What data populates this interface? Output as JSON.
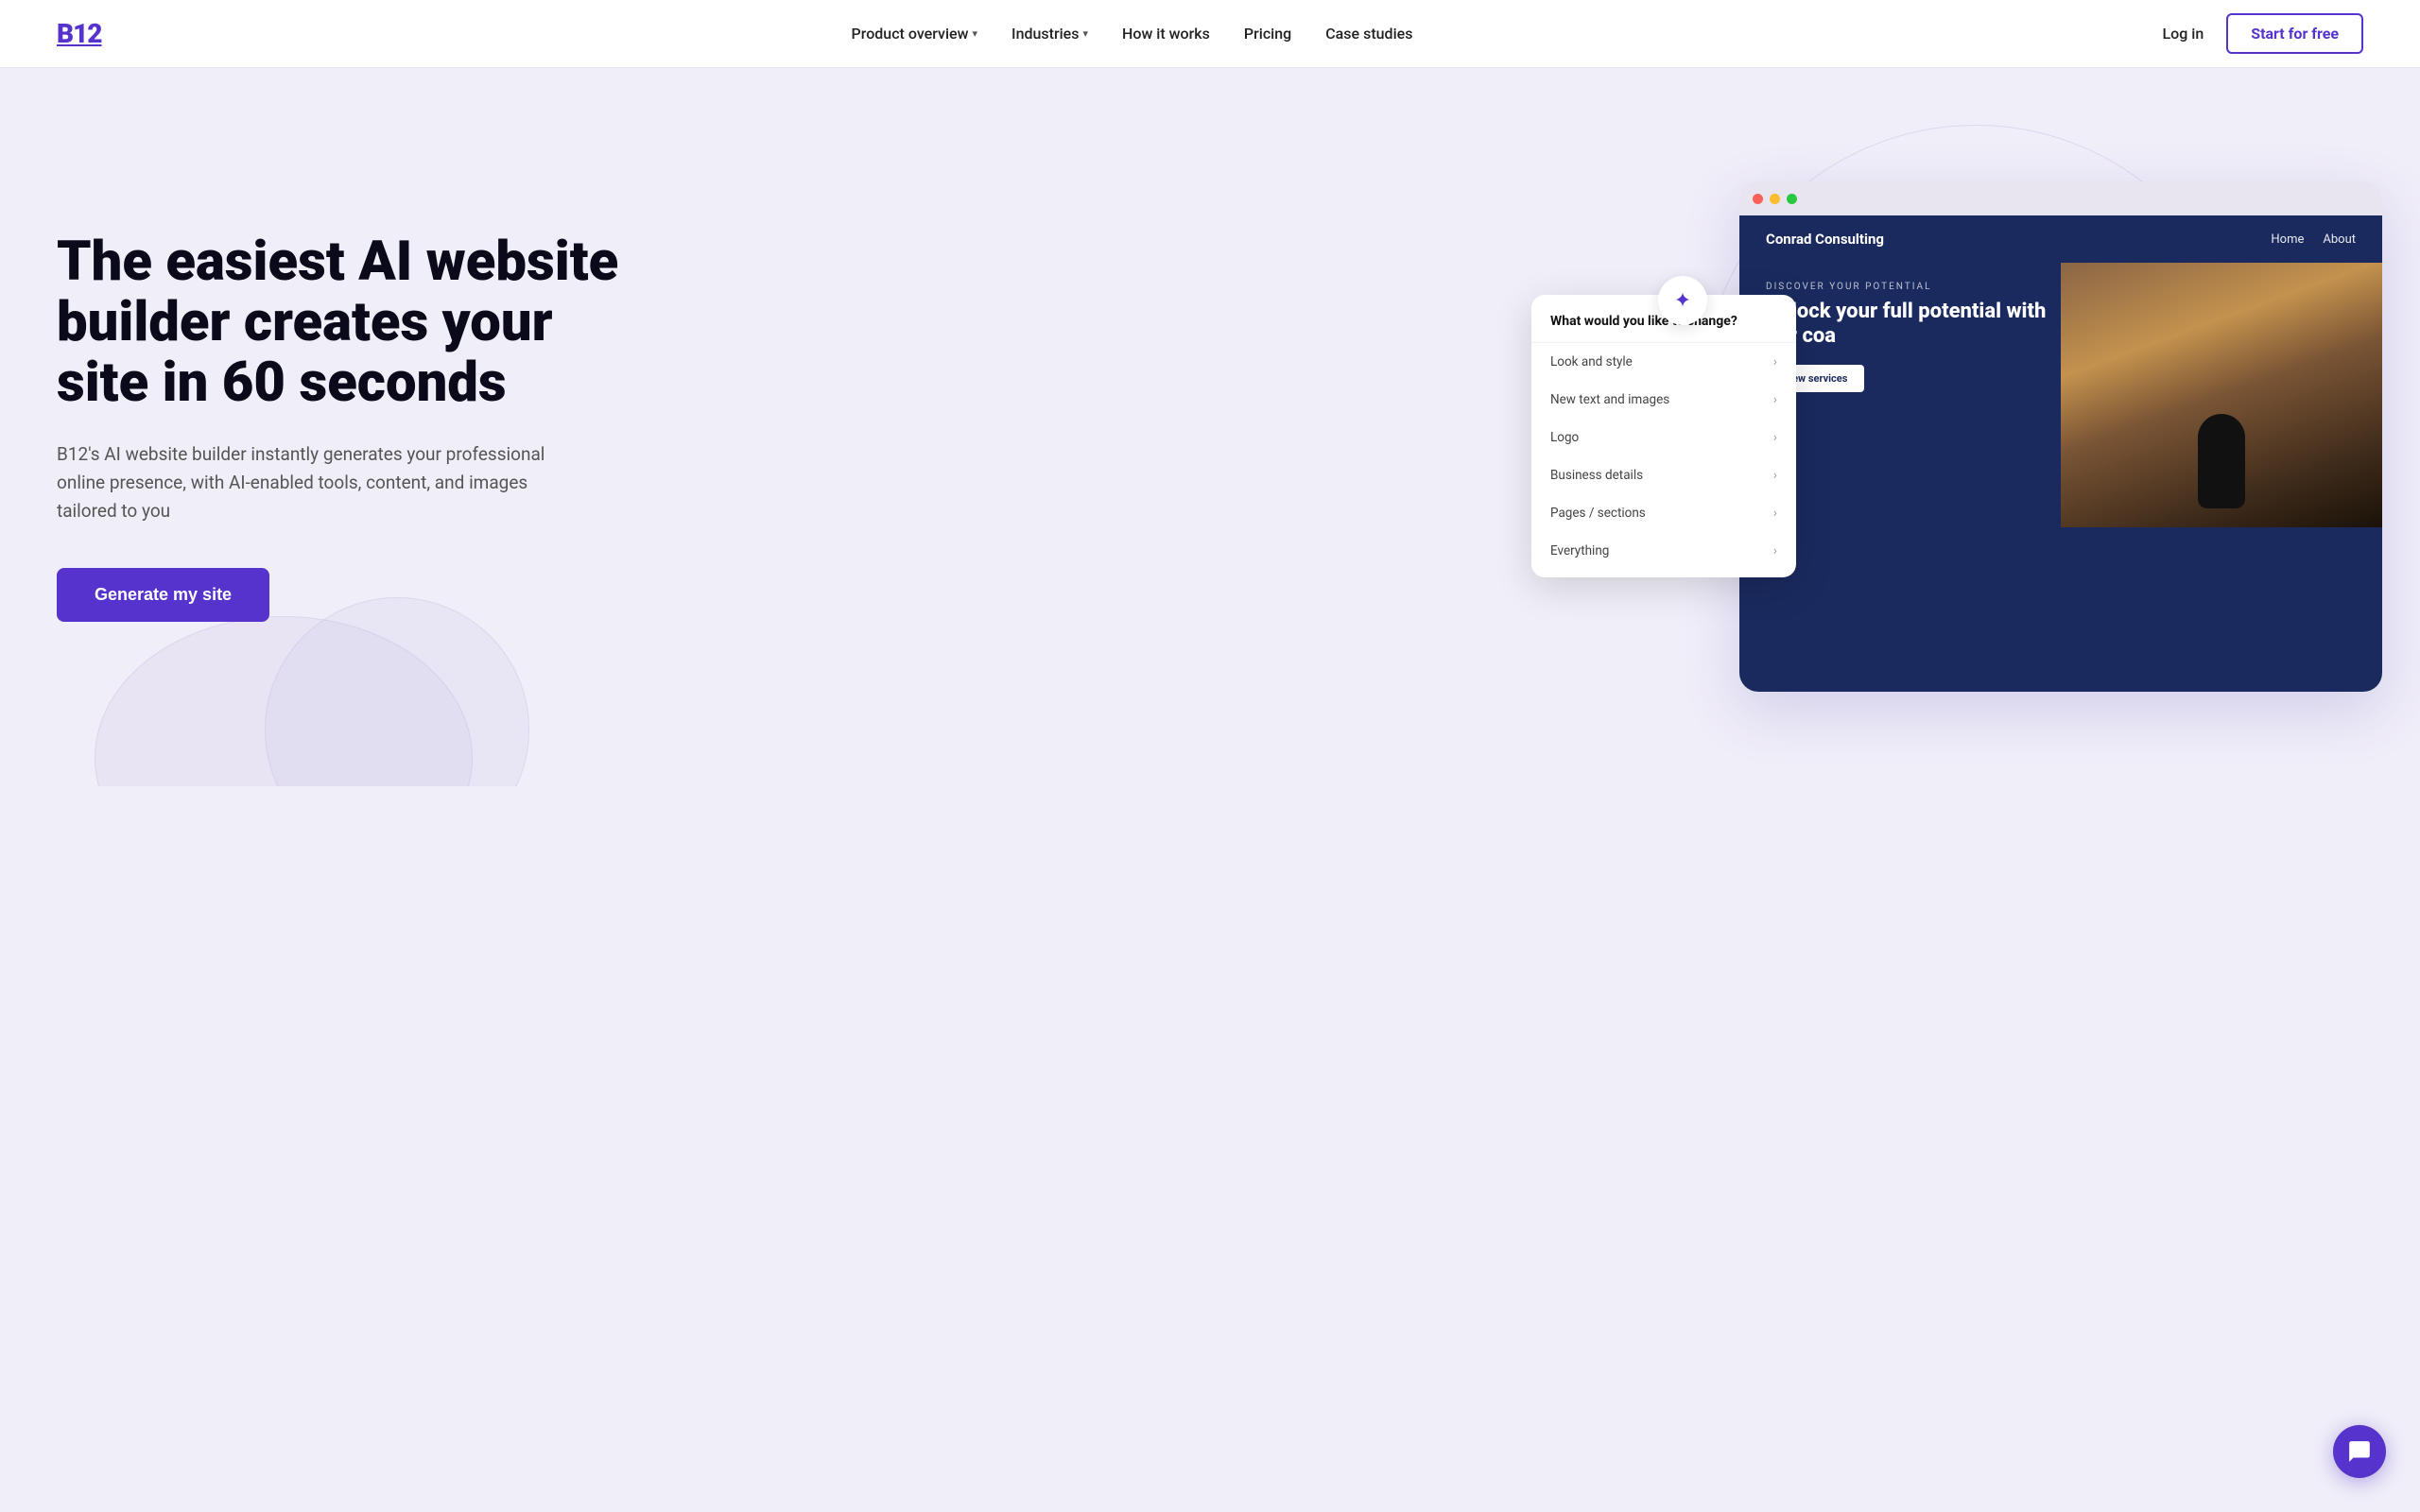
{
  "brand": {
    "name": "B12",
    "color": "#5533cc"
  },
  "nav": {
    "links": [
      {
        "label": "Product overview",
        "hasDropdown": true
      },
      {
        "label": "Industries",
        "hasDropdown": true
      },
      {
        "label": "How it works",
        "hasDropdown": false
      },
      {
        "label": "Pricing",
        "hasDropdown": false
      },
      {
        "label": "Case studies",
        "hasDropdown": false
      }
    ],
    "login_label": "Log in",
    "start_label": "Start for free"
  },
  "hero": {
    "headline": "The easiest AI website builder creates your site in 60 seconds",
    "subtext": "B12's AI website builder instantly generates your professional online presence, with AI-enabled tools, content, and images tailored to you",
    "cta_label": "Generate my site"
  },
  "mockup": {
    "website": {
      "brand": "Conrad Consulting",
      "nav_links": [
        "Home",
        "About"
      ],
      "discover_label": "DISCOVER YOUR POTENTIAL",
      "headline": "Unlock your full potential with our coa",
      "cta_label": "View services"
    },
    "ai_popup": {
      "question": "What would you like to change?",
      "items": [
        {
          "label": "Look and style"
        },
        {
          "label": "New text and images"
        },
        {
          "label": "Logo"
        },
        {
          "label": "Business details"
        },
        {
          "label": "Pages / sections"
        },
        {
          "label": "Everything"
        }
      ]
    },
    "sparkle_icon": "✦"
  },
  "chat": {
    "icon": "💬"
  }
}
